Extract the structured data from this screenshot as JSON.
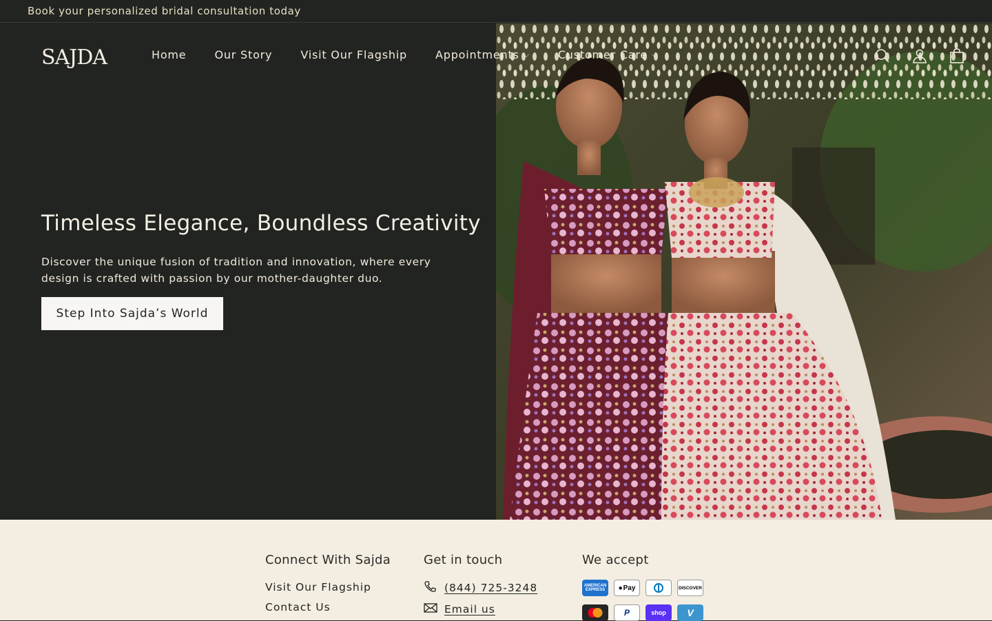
{
  "announcement": {
    "text": "Book your personalized bridal consultation today"
  },
  "brand": {
    "logo_text": "SAJDA"
  },
  "nav": {
    "items": [
      {
        "label": "Home"
      },
      {
        "label": "Our Story"
      },
      {
        "label": "Visit Our Flagship"
      },
      {
        "label": "Appointments"
      },
      {
        "label": "Customer Care"
      }
    ]
  },
  "header_icons": [
    "search-icon",
    "account-icon",
    "cart-icon"
  ],
  "hero": {
    "headline": "Timeless Elegance, Boundless Creativity",
    "subtext": "Discover the unique fusion of tradition and innovation, where every design is crafted with passion by our mother-daughter duo.",
    "cta_label": "Step Into Sajda’s World"
  },
  "footer": {
    "connect": {
      "heading": "Connect With Sajda",
      "links": [
        "Visit Our Flagship",
        "Contact Us"
      ]
    },
    "contact": {
      "heading": "Get in touch",
      "phone": "(844) 725-3248",
      "email_label": "Email us"
    },
    "payments": {
      "heading": "We accept",
      "methods": [
        "American Express",
        "Apple Pay",
        "Diners Club",
        "Discover",
        "Mastercard",
        "PayPal",
        "Shop Pay",
        "Venmo"
      ],
      "badges": {
        "amex": "AMERICAN EXPRESS",
        "applepay": "Pay",
        "discover": "DISCOVER",
        "paypal": "P",
        "shoppay": "shop",
        "venmo": "V"
      }
    }
  },
  "colors": {
    "dark_bg": "#222421",
    "cream": "#f4eee2",
    "accent_text": "#e9dfc3"
  }
}
